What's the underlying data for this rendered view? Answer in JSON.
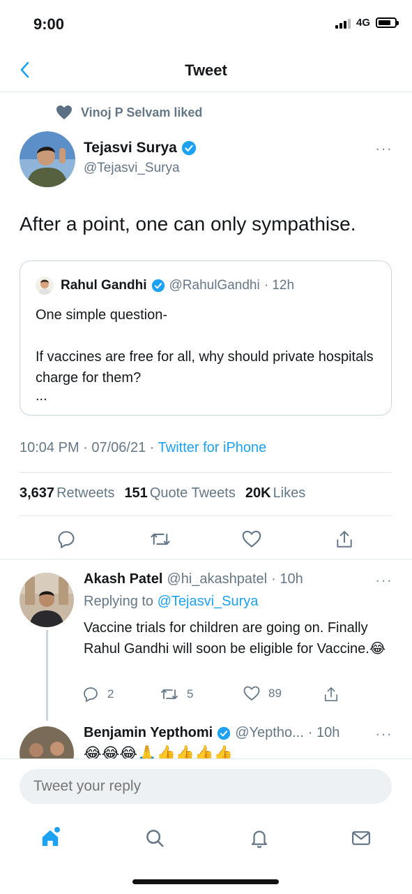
{
  "status_bar": {
    "time": "9:00",
    "network": "4G"
  },
  "nav": {
    "title": "Tweet"
  },
  "social_context": {
    "text": "Vinoj P Selvam liked"
  },
  "tweet": {
    "author_name": "Tejasvi Surya",
    "author_handle": "@Tejasvi_Surya",
    "text": "After a point, one can only sympathise.",
    "timestamp": "10:04 PM · 07/06/21 · ",
    "source": "Twitter for iPhone"
  },
  "quote": {
    "author_name": "Rahul Gandhi",
    "author_handle": "@RahulGandhi",
    "time": "· 12h",
    "line1": "One simple question-",
    "line2": "If vaccines are free for all, why should private hospitals charge for them?",
    "ellipsis": "..."
  },
  "stats": {
    "retweets_count": "3,637",
    "retweets_label": "Retweets",
    "quotes_count": "151",
    "quotes_label": "Quote Tweets",
    "likes_count": "20K",
    "likes_label": "Likes"
  },
  "replies": [
    {
      "name": "Akash Patel",
      "handle": "@hi_akashpatel",
      "time": "· 10h",
      "replying_prefix": "Replying to ",
      "replying_to": "@Tejasvi_Surya",
      "text": "Vaccine trials for children are going on. Finally Rahul Gandhi will soon be eligible for Vaccine.😂",
      "reply_count": "2",
      "retweet_count": "5",
      "like_count": "89"
    },
    {
      "name": "Benjamin Yepthomi",
      "handle": "@Yeptho...",
      "time": "· 10h",
      "text": "😂😂😂🙏👍👍👍👍"
    }
  ],
  "composer": {
    "placeholder": "Tweet your reply"
  },
  "colors": {
    "accent": "#1da1f2",
    "muted": "#657786",
    "text": "#14171a"
  },
  "icons": [
    "back-chevron-icon",
    "heart-icon",
    "verified-icon",
    "more-icon",
    "reply-icon",
    "retweet-icon",
    "like-icon",
    "share-icon",
    "home-icon",
    "search-icon",
    "notifications-icon",
    "messages-icon"
  ]
}
